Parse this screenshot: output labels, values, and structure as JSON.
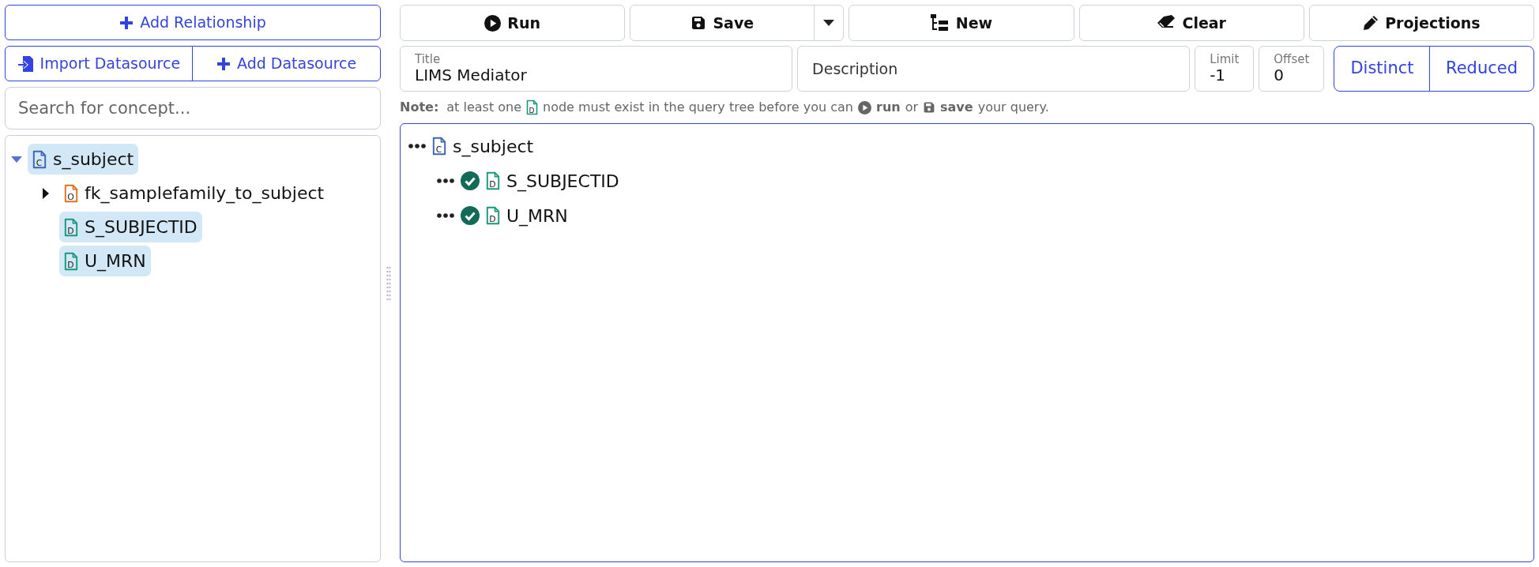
{
  "sidebar": {
    "add_relationship": "Add Relationship",
    "import_datasource": "Import Datasource",
    "add_datasource": "Add Datasource",
    "search": {
      "placeholder": "Search for concept..."
    },
    "tree": [
      {
        "kind": "class",
        "icon_letter": "C",
        "label": "s_subject",
        "selected": true,
        "expanded": true,
        "children": [
          {
            "kind": "object",
            "icon_letter": "O",
            "label": "fk_samplefamily_to_subject",
            "selected": false,
            "expanded": false
          },
          {
            "kind": "datatype",
            "icon_letter": "D",
            "label": "S_SUBJECTID",
            "selected": true
          },
          {
            "kind": "datatype",
            "icon_letter": "D",
            "label": "U_MRN",
            "selected": true
          }
        ]
      }
    ]
  },
  "toolbar": {
    "run": "Run",
    "save": "Save",
    "new": "New",
    "clear": "Clear",
    "projections": "Projections"
  },
  "fields": {
    "title": {
      "label": "Title",
      "value": "LIMS Mediator"
    },
    "description": {
      "placeholder": "Description"
    },
    "limit": {
      "label": "Limit",
      "value": "-1"
    },
    "offset": {
      "label": "Offset",
      "value": "0"
    }
  },
  "toggles": [
    {
      "label": "Distinct",
      "selected": false
    },
    {
      "label": "Reduced",
      "selected": false
    }
  ],
  "note": {
    "label": "Note:",
    "text_1": "at least one",
    "icon_letter": "D",
    "text_2": "node must exist in the query tree before you can",
    "run": "run",
    "text_3": "or",
    "save": "save",
    "text_4": "your query."
  },
  "query_tree": {
    "kind": "class",
    "icon_letter": "C",
    "label": "s_subject",
    "children": [
      {
        "kind": "datatype",
        "icon_letter": "D",
        "label": "S_SUBJECTID",
        "checked": true
      },
      {
        "kind": "datatype",
        "icon_letter": "D",
        "label": "U_MRN",
        "checked": true
      }
    ]
  }
}
